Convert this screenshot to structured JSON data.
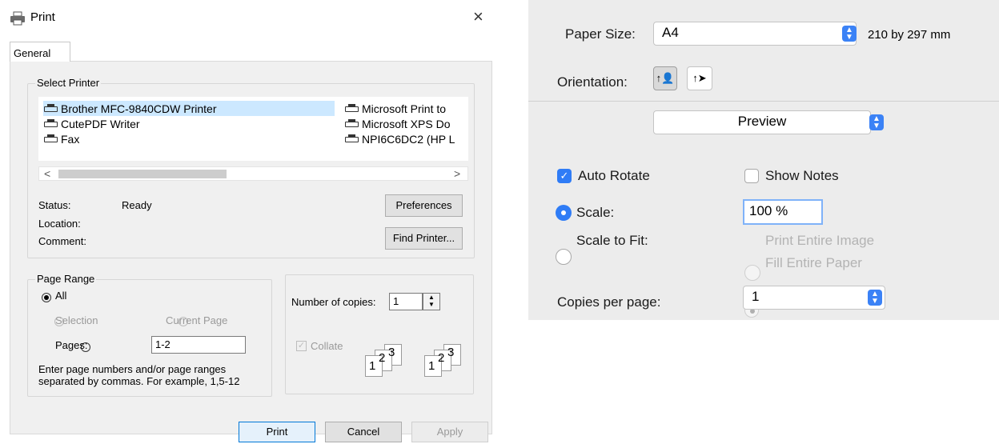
{
  "win": {
    "title": "Print",
    "close_glyph": "×",
    "tab_general": "General",
    "select_printer_label": "Select Printer",
    "printers_left": [
      "Brother MFC-9840CDW Printer",
      "CutePDF Writer",
      "Fax"
    ],
    "printers_right": [
      "Microsoft Print to",
      "Microsoft XPS Do",
      "NPI6C6DC2 (HP L"
    ],
    "scroll_left": "<",
    "scroll_right": ">",
    "status_label": "Status:",
    "status_value": "Ready",
    "location_label": "Location:",
    "comment_label": "Comment:",
    "preferences_button": "Preferences",
    "find_printer_button": "Find Printer...",
    "page_range_label": "Page Range",
    "all_label": "All",
    "selection_label": "Selection",
    "current_page_label": "Current Page",
    "pages_label": "Pages:",
    "pages_value": "1-2",
    "hint": "Enter page numbers and/or page ranges separated by commas.  For example, 1,5-12",
    "copies_label": "Number of copies:",
    "copies_value": "1",
    "collate_label": "Collate",
    "stack_digits": [
      "1",
      "2",
      "3"
    ],
    "print_button": "Print",
    "cancel_button": "Cancel",
    "apply_button": "Apply"
  },
  "mac": {
    "paper_size_label": "Paper Size:",
    "paper_size_value": "A4",
    "paper_size_dims": "210 by 297 mm",
    "orientation_label": "Orientation:",
    "preview_value": "Preview",
    "auto_rotate_label": "Auto Rotate",
    "show_notes_label": "Show Notes",
    "scale_label": "Scale:",
    "scale_value": "100 %",
    "scale_to_fit_label": "Scale to Fit:",
    "print_entire_image_label": "Print Entire Image",
    "fill_entire_paper_label": "Fill Entire Paper",
    "copies_per_page_label": "Copies per page:",
    "copies_per_page_value": "1"
  }
}
